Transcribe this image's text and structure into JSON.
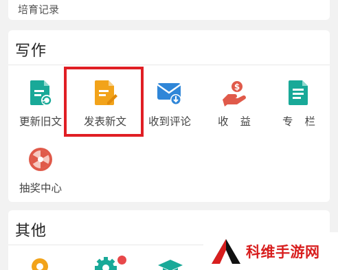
{
  "previous_section": {
    "item_label": "培育记录"
  },
  "write_section": {
    "title": "写作",
    "items": [
      {
        "label": "更新旧文",
        "icon": "update-article-icon"
      },
      {
        "label": "发表新文",
        "icon": "new-article-icon",
        "highlighted": true
      },
      {
        "label": "收到评论",
        "icon": "comment-mail-icon"
      },
      {
        "label": "收 益",
        "icon": "income-hand-icon"
      },
      {
        "label": "专 栏",
        "icon": "column-doc-icon"
      },
      {
        "label": "抽奖中心",
        "icon": "lottery-wheel-icon"
      }
    ]
  },
  "other_section": {
    "title": "其他",
    "icons": [
      "location-pin-icon",
      "settings-gear-icon",
      "graduation-cap-icon"
    ],
    "settings_has_notification": true
  },
  "watermark": {
    "text": "科维手游网"
  },
  "colors": {
    "teal": "#19a998",
    "orange": "#f2a31a",
    "blue": "#2f86d8",
    "red": "#e05a4a",
    "highlight": "#e01e24",
    "watermark_red": "#d81e1e"
  }
}
